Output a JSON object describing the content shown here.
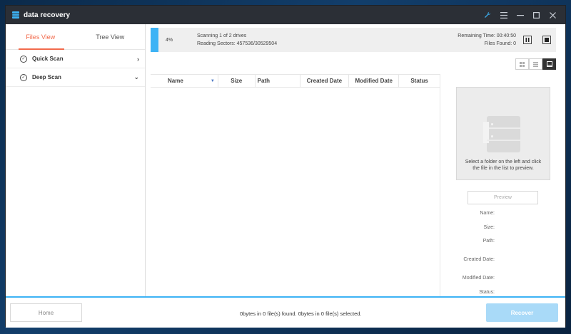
{
  "app": {
    "title": "data recovery"
  },
  "window_controls": {
    "wrench": "wrench-icon",
    "menu": "menu-icon",
    "minimize": "minimize-icon",
    "maximize": "maximize-icon",
    "close": "close-icon"
  },
  "sidebar": {
    "tabs": [
      {
        "label": "Files View",
        "active": true
      },
      {
        "label": "Tree View",
        "active": false
      }
    ],
    "items": [
      {
        "label": "Quick Scan",
        "chevron": "›"
      },
      {
        "label": "Deep Scan",
        "chevron": "⌄"
      }
    ]
  },
  "progress": {
    "percent_label": "4%",
    "percent": 4,
    "scanning_text": "Scanning 1 of  2 drives",
    "sectors_text": "Reading Sectors: 457536/30529504",
    "remaining_time": "Remaining Time: 00:40:50",
    "files_found": "Files Found: 0"
  },
  "table": {
    "columns": [
      "Name",
      "Size",
      "Path",
      "Created Date",
      "Modified Date",
      "Status"
    ],
    "rows": []
  },
  "preview": {
    "hint": "Select a folder on the left and click the file in the list to preview.",
    "button_label": "Preview",
    "fields": {
      "name": "Name:",
      "size": "Size:",
      "path": "Path:",
      "created": "Created Date:",
      "modified": "Modified Date:",
      "status": "Status:"
    }
  },
  "footer": {
    "home_label": "Home",
    "status_text": "0bytes in 0 file(s) found.   0bytes in 0 file(s) selected.",
    "recover_label": "Recover"
  },
  "colors": {
    "accent": "#3db3f5",
    "tab_active": "#f26a4b",
    "titlebar": "#2b2f36"
  }
}
